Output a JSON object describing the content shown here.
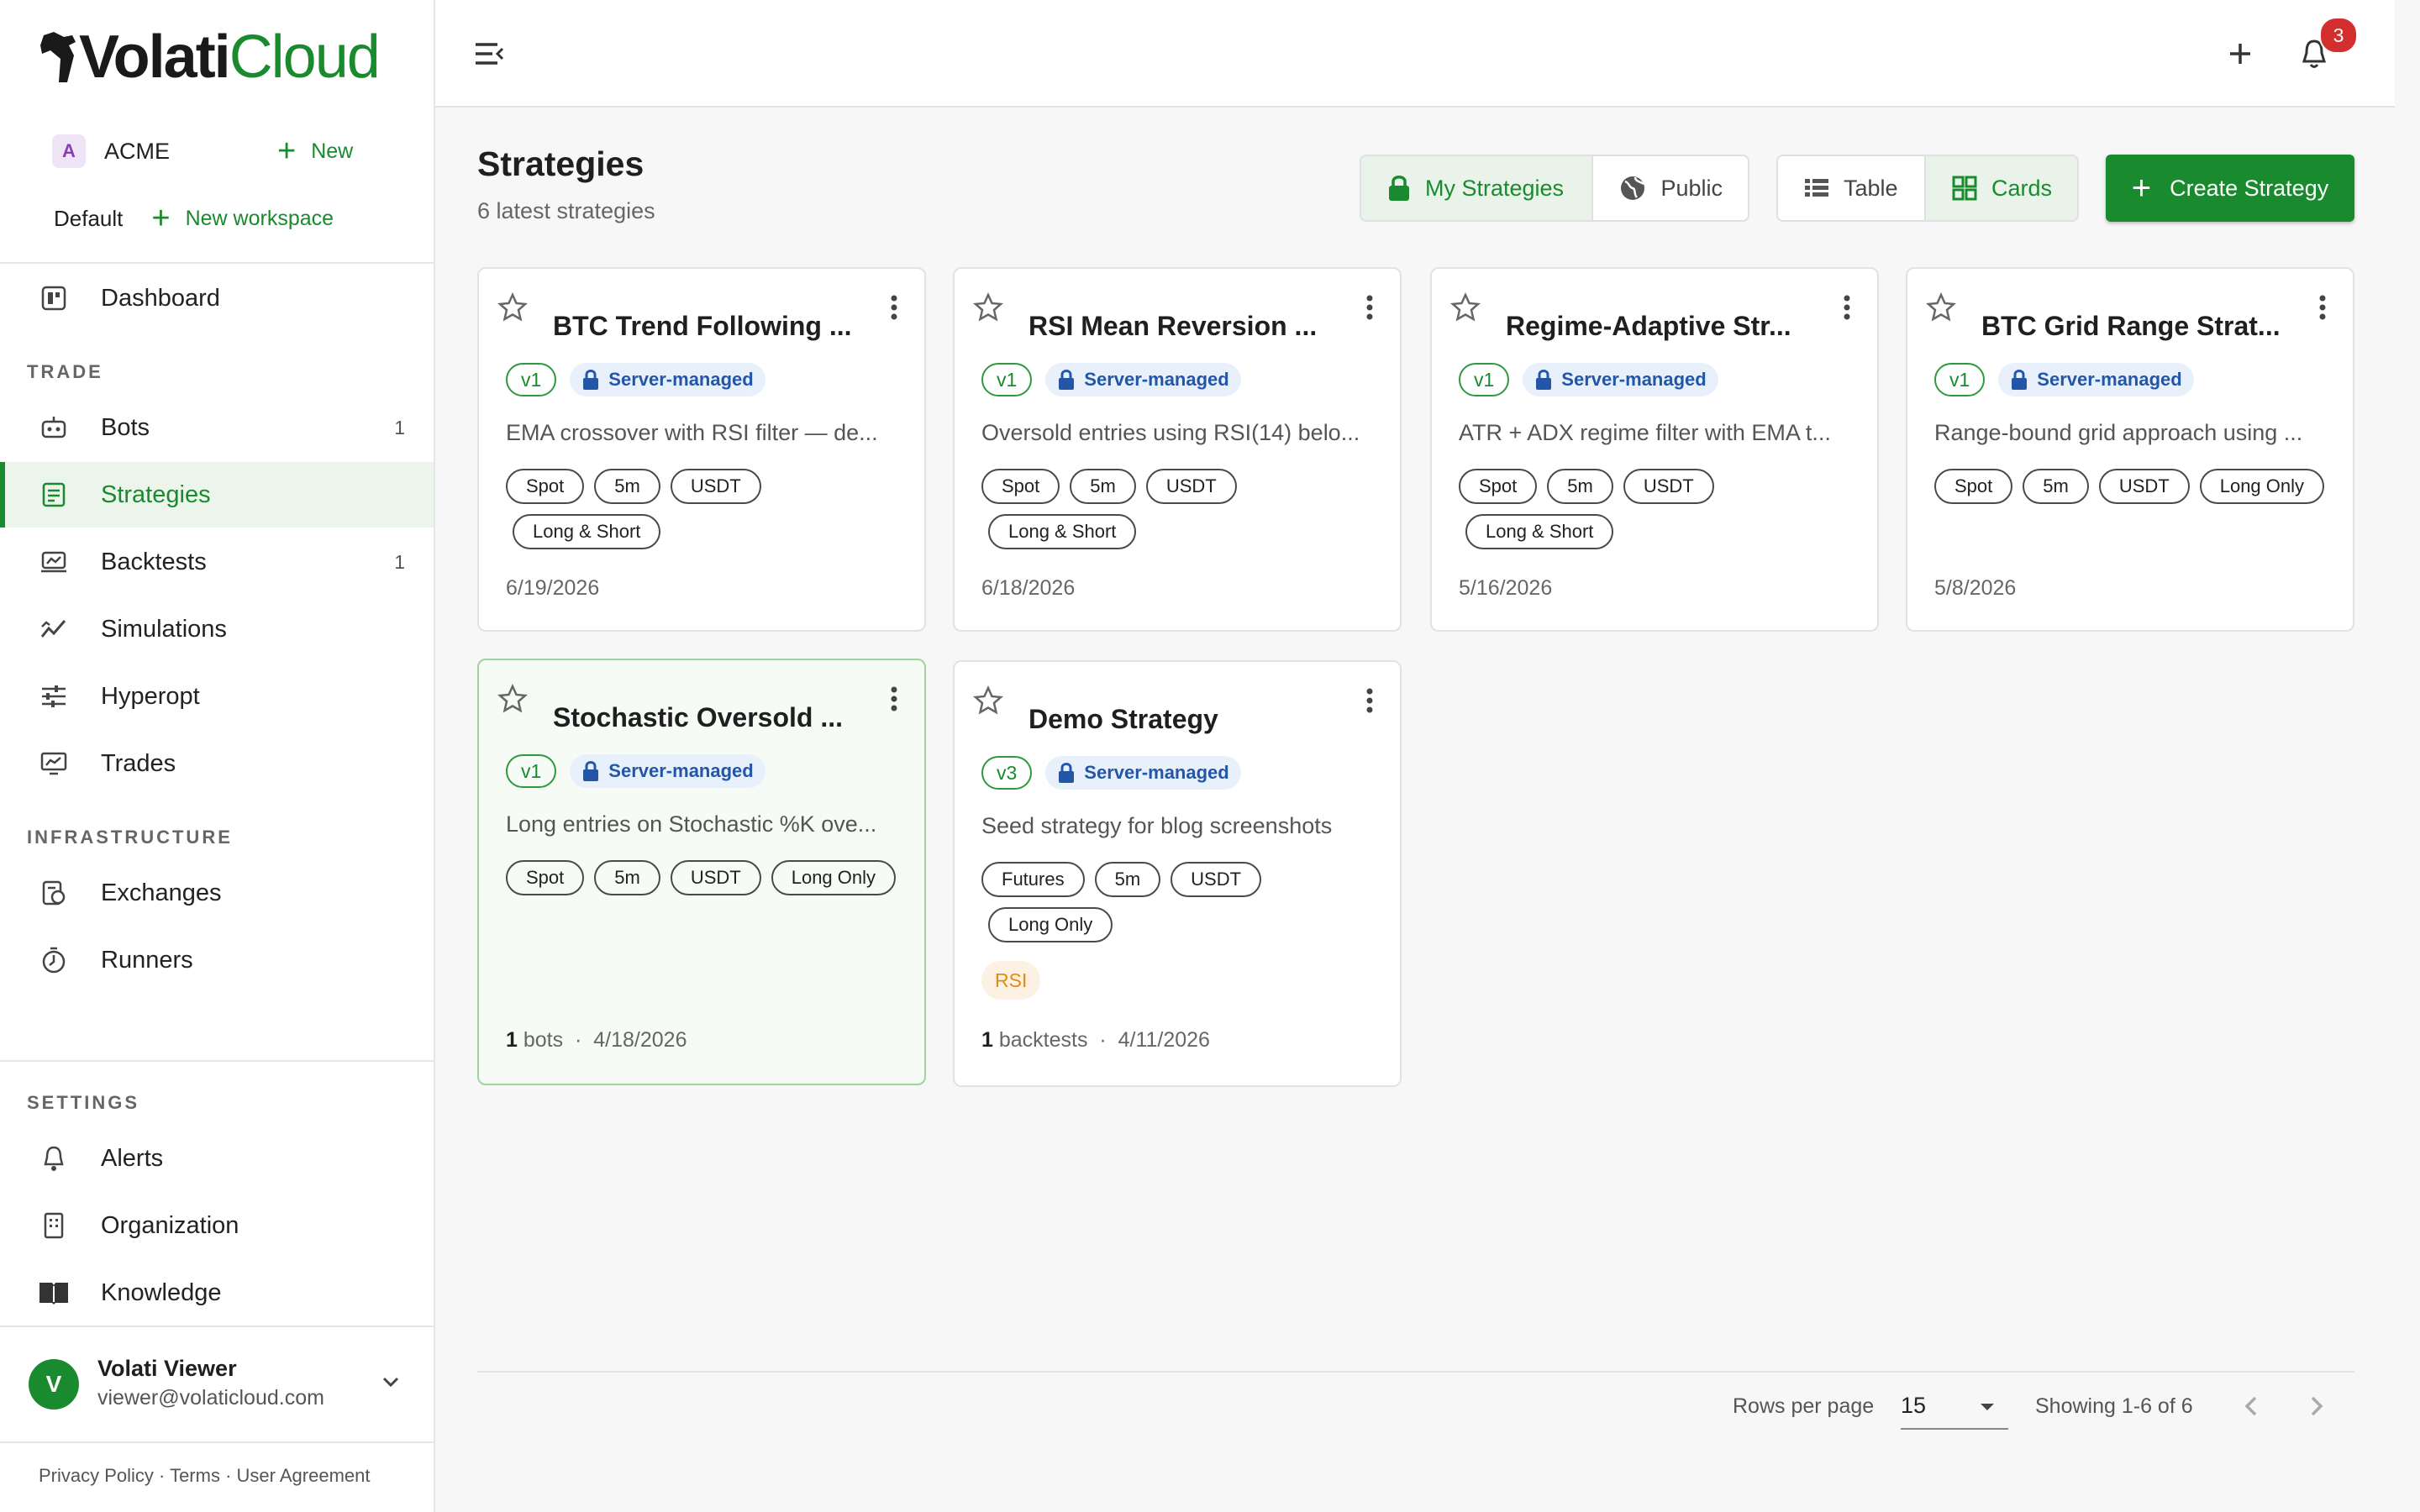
{
  "brand": {
    "name_part1": "Volati",
    "name_part2": "Cloud"
  },
  "org": {
    "avatar": "A",
    "name": "ACME",
    "new_label": "New"
  },
  "workspace": {
    "name": "Default",
    "new_label": "New workspace"
  },
  "nav": {
    "dashboard": "Dashboard",
    "trade_heading": "TRADE",
    "bots": {
      "label": "Bots",
      "count": "1"
    },
    "strategies": "Strategies",
    "backtests": {
      "label": "Backtests",
      "count": "1"
    },
    "simulations": "Simulations",
    "hyperopt": "Hyperopt",
    "trades": "Trades",
    "infra_heading": "INFRASTRUCTURE",
    "exchanges": "Exchanges",
    "runners": "Runners",
    "settings_heading": "SETTINGS",
    "alerts": "Alerts",
    "organization": "Organization",
    "knowledge": "Knowledge"
  },
  "user": {
    "avatar": "V",
    "name": "Volati Viewer",
    "email": "viewer@volaticloud.com"
  },
  "footer": {
    "links": "Privacy Policy · Terms · User Agreement"
  },
  "topbar": {
    "notification_count": "3"
  },
  "page": {
    "title": "Strategies",
    "subtitle": "6 latest strategies"
  },
  "filters": {
    "my": "My Strategies",
    "public": "Public",
    "selected": "My Strategies"
  },
  "views": {
    "table": "Table",
    "cards": "Cards",
    "selected": "Cards"
  },
  "create_label": "Create Strategy",
  "server_label": "Server-managed",
  "cards": [
    {
      "title": "BTC Trend Following ...",
      "version": "v1",
      "desc": "EMA crossover with RSI filter — de...",
      "tags": [
        "Spot",
        "5m",
        "USDT",
        "Long & Short"
      ],
      "date": "6/19/2026"
    },
    {
      "title": "RSI Mean Reversion ...",
      "version": "v1",
      "desc": "Oversold entries using RSI(14) belo...",
      "tags": [
        "Spot",
        "5m",
        "USDT",
        "Long & Short"
      ],
      "date": "6/18/2026"
    },
    {
      "title": "Regime-Adaptive Str...",
      "version": "v1",
      "desc": "ATR + ADX regime filter with EMA t...",
      "tags": [
        "Spot",
        "5m",
        "USDT",
        "Long & Short"
      ],
      "date": "5/16/2026"
    },
    {
      "title": "BTC Grid Range Strat...",
      "version": "v1",
      "desc": "Range-bound grid approach using ...",
      "tags": [
        "Spot",
        "5m",
        "USDT",
        "Long Only"
      ],
      "date": "5/8/2026"
    },
    {
      "title": "Stochastic Oversold ...",
      "version": "v1",
      "desc": "Long entries on Stochastic %K ove...",
      "tags": [
        "Spot",
        "5m",
        "USDT",
        "Long Only"
      ],
      "meta_count": "1",
      "meta_unit": "bots",
      "date": "4/18/2026"
    },
    {
      "title": "Demo Strategy",
      "version": "v3",
      "desc": "Seed strategy for blog screenshots",
      "tags": [
        "Futures",
        "5m",
        "USDT",
        "Long Only"
      ],
      "indicator": "RSI",
      "meta_count": "1",
      "meta_unit": "backtests",
      "date": "4/11/2026"
    }
  ],
  "pagination": {
    "rows_label": "Rows per page",
    "rows_value": "15",
    "showing": "Showing 1-6 of 6"
  },
  "colors": {
    "accent": "#1a8a2e",
    "badge": "#d32f2f",
    "server_bg": "#e8f0fb",
    "server_text": "#2456a8",
    "indicator": "#e28a16"
  }
}
